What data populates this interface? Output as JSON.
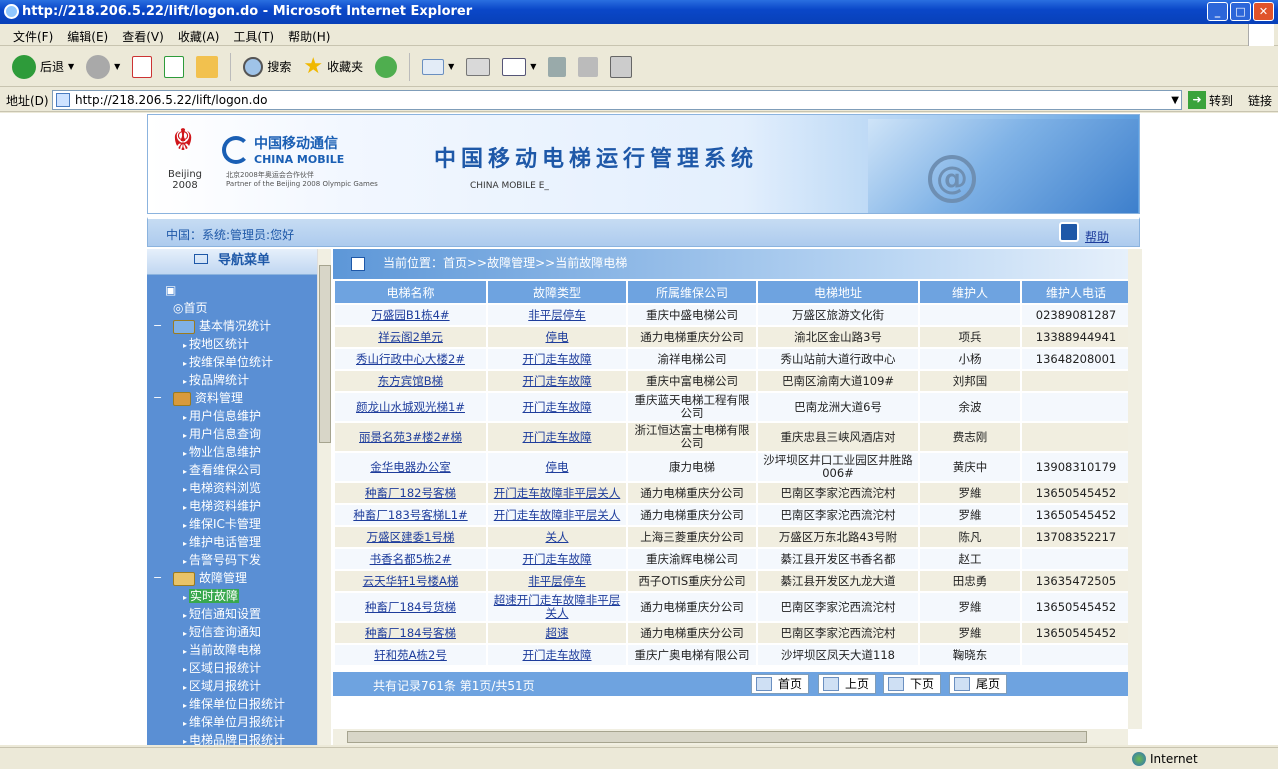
{
  "window": {
    "title": "http://218.206.5.22/lift/logon.do - Microsoft Internet Explorer"
  },
  "menu": [
    "文件(F)",
    "编辑(E)",
    "查看(V)",
    "收藏(A)",
    "工具(T)",
    "帮助(H)"
  ],
  "toolbar": {
    "back": "后退",
    "search": "搜索",
    "favorites": "收藏夹"
  },
  "address": {
    "label": "地址(D)",
    "url": "http://218.206.5.22/lift/logon.do",
    "go": "转到",
    "links": "链接"
  },
  "banner": {
    "cm_zh": "中国移动通信",
    "cm_en": "CHINA MOBILE",
    "cm_sub1": "北京2008年奥运会合作伙伴",
    "cm_sub2": "Partner of the Beijing 2008 Olympic Games",
    "title": "中国移动电梯运行管理系统",
    "subtitle": "CHINA MOBILE E_",
    "beijing": "Beijing 2008"
  },
  "userbar": {
    "greeting": "中国：系统:管理员:您好",
    "help": "帮助"
  },
  "sidebar": {
    "title": "导航菜单",
    "home": "首页",
    "groups": [
      {
        "label": "基本情况统计",
        "items": [
          "按地区统计",
          "按维保单位统计",
          "按品牌统计"
        ]
      },
      {
        "label": "资料管理",
        "items": [
          "用户信息维护",
          "用户信息查询",
          "物业信息维护",
          "查看维保公司",
          "电梯资料浏览",
          "电梯资料维护",
          "维保IC卡管理",
          "维护电话管理",
          "告警号码下发"
        ]
      },
      {
        "label": "故障管理",
        "items": [
          "实时故障",
          "短信通知设置",
          "短信查询通知",
          "当前故障电梯",
          "区域日报统计",
          "区域月报统计",
          "维保单位日报统计",
          "维保单位月报统计",
          "电梯品牌日报统计"
        ]
      }
    ]
  },
  "breadcrumb": "当前位置：首页>>故障管理>>当前故障电梯",
  "table": {
    "headers": [
      "电梯名称",
      "故障类型",
      "所属维保公司",
      "电梯地址",
      "维护人",
      "维护人电话"
    ],
    "rows": [
      [
        "万盛园B1栋4#",
        "非平层停车",
        "重庆中盛电梯公司",
        "万盛区旅游文化街",
        "",
        "02389081287"
      ],
      [
        "祥云阁2单元",
        "停电",
        "通力电梯重庆分公司",
        "渝北区金山路3号",
        "项兵",
        "13388944941"
      ],
      [
        "秀山行政中心大楼2#",
        "开门走车故障",
        "渝祥电梯公司",
        "秀山站前大道行政中心",
        "小杨",
        "13648208001"
      ],
      [
        "东方宾馆B梯",
        "开门走车故障",
        "重庆中富电梯公司",
        "巴南区渝南大道109#",
        "刘邦国",
        ""
      ],
      [
        "颜龙山水城观光梯1#",
        "开门走车故障",
        "重庆蓝天电梯工程有限公司",
        "巴南龙洲大道6号",
        "余波",
        ""
      ],
      [
        "丽景名苑3#楼2#梯",
        "开门走车故障",
        "浙江恒达富士电梯有限公司",
        "重庆忠县三峡风酒店对",
        "费志刚",
        ""
      ],
      [
        "金华电器办公室",
        "停电",
        "康力电梯",
        "沙坪坝区井口工业园区井胜路006#",
        "黄庆中",
        "13908310179"
      ],
      [
        "种畜厂182号客梯",
        "开门走车故障非平层关人",
        "通力电梯重庆分公司",
        "巴南区李家沱西流沱村",
        "罗維",
        "13650545452"
      ],
      [
        "种畜厂183号客梯L1#",
        "开门走车故障非平层关人",
        "通力电梯重庆分公司",
        "巴南区李家沱西流沱村",
        "罗維",
        "13650545452"
      ],
      [
        "万盛区建委1号梯",
        "关人",
        "上海三菱重庆分公司",
        "万盛区万东北路43号附",
        "陈凡",
        "13708352217"
      ],
      [
        "书香名都5栋2#",
        "开门走车故障",
        "重庆渝辉电梯公司",
        "綦江县开发区书香名都",
        "赵工",
        ""
      ],
      [
        "云天华轩1号楼A梯",
        "非平层停车",
        "西子OTIS重庆分公司",
        "綦江县开发区九龙大道",
        "田忠勇",
        "13635472505"
      ],
      [
        "种畜厂184号货梯",
        "超速开门走车故障非平层关人",
        "通力电梯重庆分公司",
        "巴南区李家沱西流沱村",
        "罗維",
        "13650545452"
      ],
      [
        "种畜厂184号客梯",
        "超速",
        "通力电梯重庆分公司",
        "巴南区李家沱西流沱村",
        "罗維",
        "13650545452"
      ],
      [
        "轩和苑A栋2号",
        "开门走车故障",
        "重庆广奥电梯有限公司",
        "沙坪坝区凤天大道118",
        "鞠晓东",
        ""
      ]
    ]
  },
  "pager": {
    "info": "共有记录761条  第1页/共51页",
    "first": "首页",
    "prev": "上页",
    "next": "下页",
    "last": "尾页"
  },
  "status": {
    "zone": "Internet"
  }
}
